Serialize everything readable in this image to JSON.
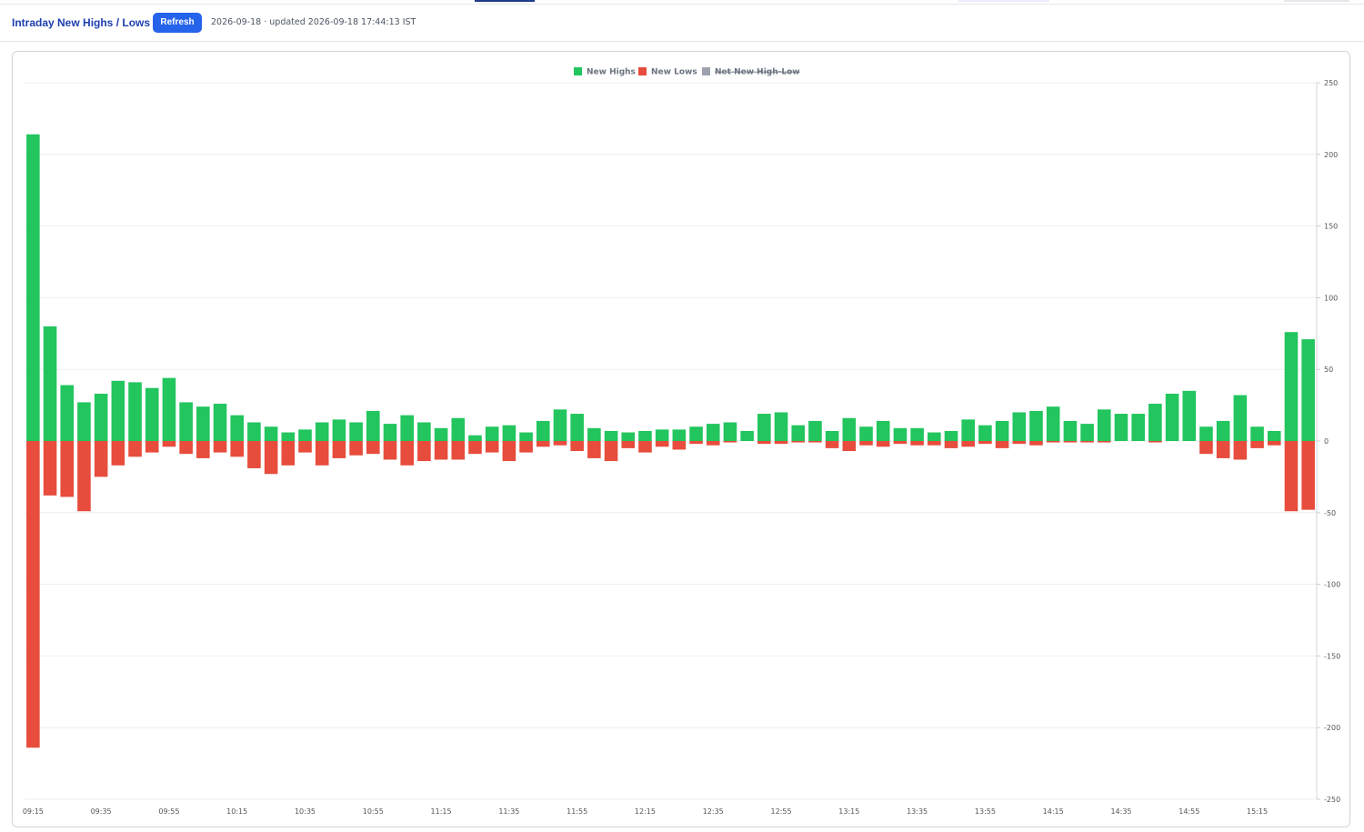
{
  "header": {
    "title": "Intraday New Highs / Lows",
    "refresh_label": "Refresh",
    "status": "2026-09-18 · updated 2026-09-18 17:44:13 IST"
  },
  "colors": {
    "highs": "#22c55e",
    "lows": "#e74c3c",
    "net": "#9ca3af",
    "accent": "#2563eb",
    "title": "#1e40af"
  },
  "chart_data": {
    "type": "bar",
    "stacked": true,
    "interval_minutes": 5,
    "categories": [
      "09:15",
      "09:20",
      "09:25",
      "09:30",
      "09:35",
      "09:40",
      "09:45",
      "09:50",
      "09:55",
      "10:00",
      "10:05",
      "10:10",
      "10:15",
      "10:20",
      "10:25",
      "10:30",
      "10:35",
      "10:40",
      "10:45",
      "10:50",
      "10:55",
      "11:00",
      "11:05",
      "11:10",
      "11:15",
      "11:20",
      "11:25",
      "11:30",
      "11:35",
      "11:40",
      "11:45",
      "11:50",
      "11:55",
      "12:00",
      "12:05",
      "12:10",
      "12:15",
      "12:20",
      "12:25",
      "12:30",
      "12:35",
      "12:40",
      "12:45",
      "12:50",
      "12:55",
      "13:00",
      "13:05",
      "13:10",
      "13:15",
      "13:20",
      "13:25",
      "13:30",
      "13:35",
      "13:40",
      "13:45",
      "13:50",
      "13:55",
      "14:00",
      "14:05",
      "14:10",
      "14:15",
      "14:20",
      "14:25",
      "14:30",
      "14:35",
      "14:40",
      "14:45",
      "14:50",
      "14:55",
      "15:00",
      "15:05",
      "15:10",
      "15:15",
      "15:20",
      "15:25",
      "15:30"
    ],
    "x_tick_labels": [
      "09:15",
      "09:35",
      "09:55",
      "10:15",
      "10:35",
      "10:55",
      "11:15",
      "11:35",
      "11:55",
      "12:15",
      "12:35",
      "12:55",
      "13:15",
      "13:35",
      "13:55",
      "14:15",
      "14:35",
      "14:55",
      "15:15"
    ],
    "series": [
      {
        "name": "New Highs",
        "values": [
          214,
          80,
          39,
          27,
          33,
          42,
          41,
          37,
          44,
          27,
          24,
          26,
          18,
          13,
          10,
          6,
          8,
          13,
          15,
          13,
          21,
          12,
          18,
          13,
          9,
          16,
          4,
          10,
          11,
          6,
          14,
          22,
          19,
          9,
          7,
          6,
          7,
          8,
          8,
          10,
          12,
          13,
          7,
          19,
          20,
          11,
          14,
          7,
          16,
          10,
          14,
          9,
          9,
          6,
          7,
          15,
          11,
          14,
          20,
          21,
          24,
          14,
          12,
          22,
          19,
          19,
          26,
          33,
          35,
          10,
          14,
          32,
          10,
          7,
          76,
          71
        ]
      },
      {
        "name": "New Lows",
        "values": [
          -214,
          -38,
          -39,
          -49,
          -25,
          -17,
          -11,
          -8,
          -4,
          -9,
          -12,
          -8,
          -11,
          -19,
          -23,
          -17,
          -8,
          -17,
          -12,
          -10,
          -9,
          -13,
          -17,
          -14,
          -13,
          -13,
          -9,
          -8,
          -14,
          -8,
          -4,
          -3,
          -7,
          -12,
          -14,
          -5,
          -8,
          -4,
          -6,
          -2,
          -3,
          -1,
          0,
          -2,
          -2,
          -1,
          -1,
          -5,
          -7,
          -3,
          -4,
          -2,
          -3,
          -3,
          -5,
          -4,
          -2,
          -5,
          -2,
          -3,
          -1,
          -1,
          -1,
          -1,
          0,
          0,
          -1,
          0,
          0,
          -9,
          -12,
          -13,
          -5,
          -3,
          -49,
          -48
        ]
      },
      {
        "name": "Net New High-Low",
        "hidden": true
      }
    ],
    "ylim": [
      -250,
      250
    ],
    "yticks": [
      250,
      200,
      150,
      100,
      50,
      0,
      -50,
      -100,
      -150,
      -200,
      -250
    ],
    "y_axis_position": "right",
    "grid": true,
    "legend_position": "top-center"
  }
}
